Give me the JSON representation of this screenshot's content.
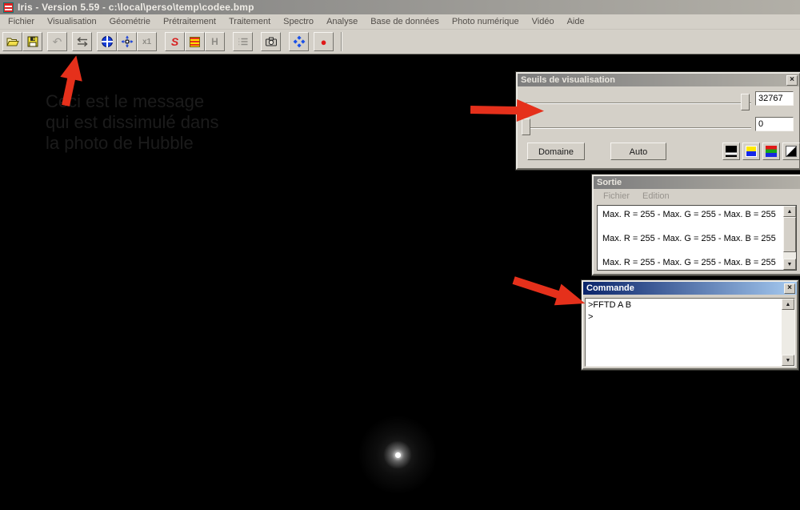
{
  "colors": {
    "chrome": "#d4d0c8",
    "inactive_title_start": "#7d7d7d",
    "inactive_title_end": "#b2afa7",
    "active_title_start": "#0a246a",
    "active_title_end": "#a6caf0",
    "arrow_red": "#e5301b",
    "hidden_text": "#1b1b1b"
  },
  "window": {
    "title": "Iris - Version 5.59 - c:\\local\\perso\\temp\\codee.bmp"
  },
  "menu": {
    "items": [
      "Fichier",
      "Visualisation",
      "Géométrie",
      "Prétraitement",
      "Traitement",
      "Spectro",
      "Analyse",
      "Base de données",
      "Photo numérique",
      "Vidéo",
      "Aide"
    ]
  },
  "toolbar": {
    "buttons": [
      "open",
      "save",
      "undo",
      "visualization-thresholds",
      "center-object",
      "move",
      "zoom-x1",
      "rotate",
      "text-output",
      "histogram",
      "command-list",
      "camera",
      "rgb-balance",
      "record"
    ],
    "x1_label": "x1",
    "h_label": "H",
    "s_label": "S"
  },
  "hidden_message": {
    "lines": [
      "Ceci est le message",
      "qui est dissimulé dans",
      "la photo de Hubble"
    ]
  },
  "seuils": {
    "title": "Seuils de visualisation",
    "high_value": "32767",
    "low_value": "0",
    "domaine_label": "Domaine",
    "auto_label": "Auto"
  },
  "sortie": {
    "title": "Sortie",
    "menu": [
      "Fichier",
      "Edition"
    ],
    "lines": [
      "Max. R = 255 - Max. G = 255 - Max. B = 255",
      "Max. R = 255 - Max. G = 255 - Max. B = 255",
      "Max. R = 255 - Max. G = 255 - Max. B = 255"
    ]
  },
  "commande": {
    "title": "Commande",
    "lines": [
      ">FFTD A B",
      ">"
    ]
  },
  "glyphs": {
    "close": "×",
    "scroll_up": "▲",
    "scroll_down": "▼",
    "undo": "↶",
    "record": "●"
  }
}
